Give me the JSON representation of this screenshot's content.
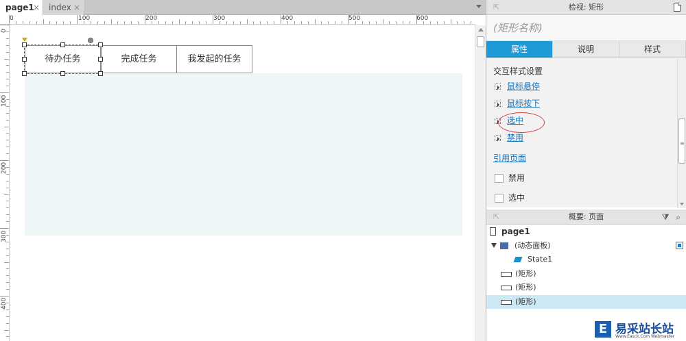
{
  "tabs": [
    {
      "label": "page1",
      "close": "×"
    },
    {
      "label": "index",
      "close": "×"
    }
  ],
  "ruler": {
    "h_labels": [
      "0",
      "100",
      "200",
      "300",
      "400",
      "500",
      "600"
    ],
    "v_labels": [
      "0",
      "100",
      "200",
      "300",
      "400"
    ]
  },
  "canvas": {
    "buttons": [
      "待办任务",
      "完成任务",
      "我发起的任务"
    ]
  },
  "inspector": {
    "title": "检视: 矩形",
    "shape_name_placeholder": "(矩形名称)",
    "tabs": [
      "属性",
      "说明",
      "样式"
    ],
    "section_title": "交互样式设置",
    "interactions": [
      "鼠标悬停",
      "鼠标按下",
      "选中",
      "禁用"
    ],
    "ref_page": "引用页面",
    "checkboxes": [
      "禁用",
      "选中"
    ]
  },
  "outline": {
    "title": "概要: 页面",
    "page": "page1",
    "items": [
      {
        "label": "(动态面板)",
        "type": "dynamic-panel"
      },
      {
        "label": "State1",
        "type": "state"
      },
      {
        "label": "(矩形)",
        "type": "rect"
      },
      {
        "label": "(矩形)",
        "type": "rect"
      },
      {
        "label": "(矩形)",
        "type": "rect"
      }
    ]
  },
  "watermark": {
    "logo": "E",
    "text": "易采站长站",
    "sub": "Www.Easck.Com Webmaster"
  },
  "colors": {
    "accent": "#1e9bd7",
    "selection": "#2aa52a",
    "highlight": "#e0454b",
    "link": "#1a73b8"
  }
}
